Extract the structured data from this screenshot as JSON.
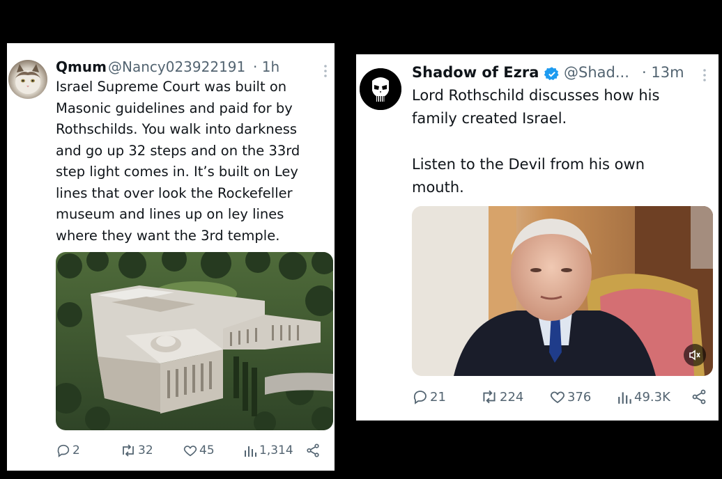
{
  "left_tweet": {
    "display_name": "Qmum",
    "handle": "@Nancy023922191",
    "time": "· 1h",
    "text": "Israel Supreme Court was built on\nMasonic guidelines and paid for by\nRothschilds. You walk into darkness\nand go up 32 steps and on the 33rd\nstep light comes in. It’s built on Ley\nlines that over look the Rockefeller\nmuseum and lines up on ley lines\nwhere they want the 3rd temple.",
    "replies": "2",
    "reposts": "32",
    "likes": "45",
    "views": "1,314",
    "avatar_icon": "cat-avatar-icon"
  },
  "right_tweet": {
    "display_name": "Shadow of Ezra",
    "handle": "@Shad...",
    "time": "· 13m",
    "text": "Lord Rothschild discusses how his\nfamily created Israel.\n\nListen to the Devil from his own\nmouth.",
    "replies": "21",
    "reposts": "224",
    "likes": "376",
    "views": "49.3K",
    "avatar_icon": "punisher-skull-icon"
  },
  "colors": {
    "background": "#000000",
    "card": "#ffffff",
    "secondary_text": "#536471",
    "verified_blue": "#1d9bf0"
  }
}
